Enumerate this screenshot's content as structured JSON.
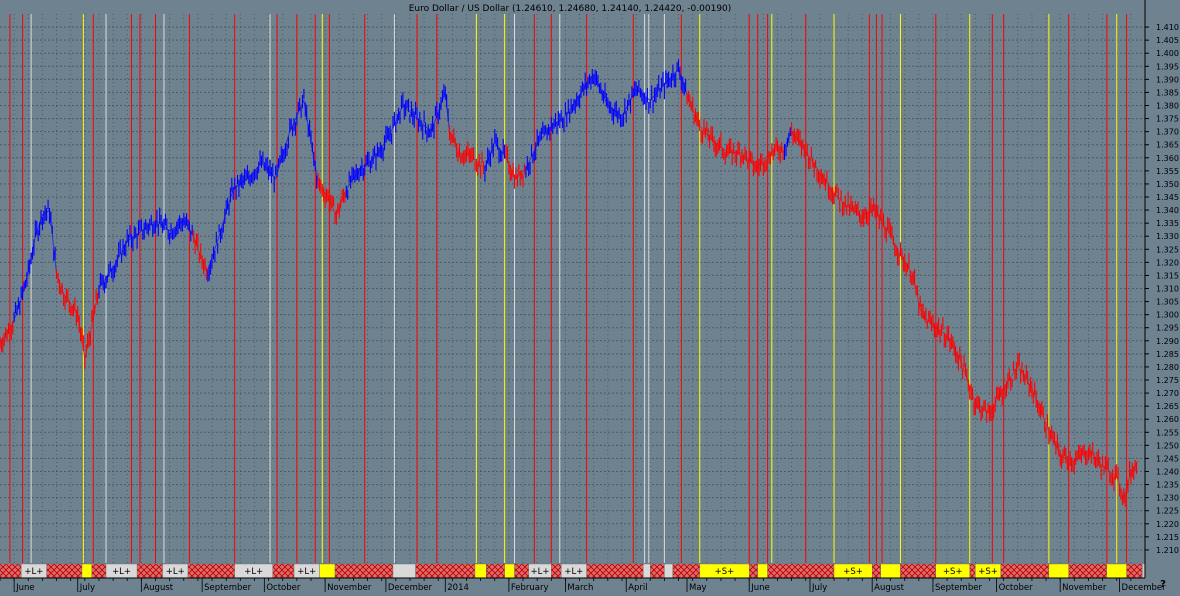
{
  "title": "Euro Dollar / US Dollar (1.24610, 1.24680, 1.24140, 1.24420, -0.00190)",
  "corner_mark": "?",
  "chart_data": {
    "type": "line",
    "title": "Euro Dollar / US Dollar (1.24610, 1.24680, 1.24140, 1.24420, -0.00190)",
    "ylim": [
      1.205,
      1.415
    ],
    "yticks": [
      "1.210",
      "1.215",
      "1.220",
      "1.225",
      "1.230",
      "1.235",
      "1.240",
      "1.245",
      "1.250",
      "1.255",
      "1.260",
      "1.265",
      "1.270",
      "1.275",
      "1.280",
      "1.285",
      "1.290",
      "1.295",
      "1.300",
      "1.305",
      "1.310",
      "1.315",
      "1.320",
      "1.325",
      "1.330",
      "1.335",
      "1.340",
      "1.345",
      "1.350",
      "1.355",
      "1.360",
      "1.365",
      "1.370",
      "1.375",
      "1.380",
      "1.385",
      "1.390",
      "1.395",
      "1.400",
      "1.405",
      "1.410"
    ],
    "month_labels": [
      {
        "label": "June",
        "week": 1
      },
      {
        "label": "July",
        "week": 5.5
      },
      {
        "label": "August",
        "week": 10
      },
      {
        "label": "September",
        "week": 14.3
      },
      {
        "label": "October",
        "week": 18.7
      },
      {
        "label": "November",
        "week": 23
      },
      {
        "label": "December",
        "week": 27.3
      },
      {
        "label": "2014",
        "week": 31.5
      },
      {
        "label": "February",
        "week": 36
      },
      {
        "label": "March",
        "week": 40
      },
      {
        "label": "April",
        "week": 44.3
      },
      {
        "label": "May",
        "week": 48.6
      },
      {
        "label": "June",
        "week": 53
      },
      {
        "label": "July",
        "week": 57.3
      },
      {
        "label": "August",
        "week": 61.7
      },
      {
        "label": "September",
        "week": 66
      },
      {
        "label": "October",
        "week": 70.5
      },
      {
        "label": "November",
        "week": 75
      },
      {
        "label": "December",
        "week": 79.2
      }
    ],
    "series": [
      {
        "color": "#ff0000",
        "points": [
          [
            0,
            1.289
          ],
          [
            0.6,
            1.294
          ],
          [
            1.0,
            1.298
          ]
        ]
      },
      {
        "color": "#0000ff",
        "points": [
          [
            1.0,
            1.298
          ],
          [
            1.5,
            1.306
          ],
          [
            2,
            1.316
          ],
          [
            2.5,
            1.33
          ],
          [
            3,
            1.338
          ],
          [
            3.5,
            1.34
          ],
          [
            4,
            1.316
          ]
        ]
      },
      {
        "color": "#ff0000",
        "points": [
          [
            4,
            1.316
          ],
          [
            4.5,
            1.308
          ],
          [
            5,
            1.304
          ],
          [
            5.5,
            1.3
          ],
          [
            6,
            1.283
          ],
          [
            6.5,
            1.296
          ],
          [
            7,
            1.31
          ]
        ]
      },
      {
        "color": "#0000ff",
        "points": [
          [
            7,
            1.31
          ],
          [
            8,
            1.318
          ],
          [
            9,
            1.328
          ],
          [
            10,
            1.332
          ],
          [
            11,
            1.336
          ],
          [
            12,
            1.332
          ],
          [
            13,
            1.336
          ],
          [
            13.7,
            1.33
          ]
        ]
      },
      {
        "color": "#ff0000",
        "points": [
          [
            13.7,
            1.33
          ],
          [
            14.2,
            1.322
          ],
          [
            14.7,
            1.317
          ]
        ]
      },
      {
        "color": "#0000ff",
        "points": [
          [
            14.7,
            1.317
          ],
          [
            15.5,
            1.33
          ],
          [
            16.5,
            1.348
          ],
          [
            17.5,
            1.352
          ],
          [
            18.5,
            1.358
          ],
          [
            19.5,
            1.352
          ],
          [
            20.5,
            1.37
          ],
          [
            21.5,
            1.382
          ],
          [
            22.5,
            1.35
          ]
        ]
      },
      {
        "color": "#ff0000",
        "points": [
          [
            22.5,
            1.35
          ],
          [
            23.2,
            1.345
          ],
          [
            23.8,
            1.338
          ],
          [
            24.5,
            1.348
          ]
        ]
      },
      {
        "color": "#0000ff",
        "points": [
          [
            24.5,
            1.348
          ],
          [
            25.5,
            1.356
          ],
          [
            26.5,
            1.36
          ],
          [
            27.5,
            1.368
          ],
          [
            28.5,
            1.38
          ],
          [
            29.5,
            1.375
          ],
          [
            30.5,
            1.37
          ],
          [
            31.5,
            1.385
          ],
          [
            31.8,
            1.37
          ]
        ]
      },
      {
        "color": "#ff0000",
        "points": [
          [
            31.8,
            1.37
          ],
          [
            32.5,
            1.362
          ],
          [
            33.5,
            1.36
          ],
          [
            34.3,
            1.356
          ]
        ]
      },
      {
        "color": "#0000ff",
        "points": [
          [
            34.3,
            1.356
          ],
          [
            35,
            1.366
          ],
          [
            35.8,
            1.36
          ]
        ]
      },
      {
        "color": "#ff0000",
        "points": [
          [
            35.8,
            1.36
          ],
          [
            36.5,
            1.352
          ],
          [
            37.2,
            1.356
          ]
        ]
      },
      {
        "color": "#0000ff",
        "points": [
          [
            37.2,
            1.356
          ],
          [
            38,
            1.365
          ],
          [
            39,
            1.372
          ],
          [
            40,
            1.376
          ],
          [
            41,
            1.384
          ],
          [
            42,
            1.392
          ],
          [
            43,
            1.38
          ],
          [
            44,
            1.376
          ],
          [
            45,
            1.386
          ],
          [
            46,
            1.382
          ],
          [
            47,
            1.388
          ],
          [
            48,
            1.394
          ],
          [
            48.6,
            1.384
          ]
        ]
      },
      {
        "color": "#ff0000",
        "points": [
          [
            48.6,
            1.384
          ],
          [
            49.5,
            1.372
          ],
          [
            50.5,
            1.366
          ],
          [
            51.5,
            1.362
          ],
          [
            52.5,
            1.362
          ],
          [
            53.5,
            1.356
          ],
          [
            54.5,
            1.362
          ],
          [
            55.5,
            1.364
          ]
        ]
      },
      {
        "color": "#0000ff",
        "points": [
          [
            55.5,
            1.364
          ],
          [
            56,
            1.37
          ]
        ]
      },
      {
        "color": "#ff0000",
        "points": [
          [
            56,
            1.37
          ],
          [
            56.8,
            1.364
          ],
          [
            57.8,
            1.356
          ],
          [
            58.8,
            1.348
          ],
          [
            59.8,
            1.342
          ],
          [
            60.8,
            1.338
          ],
          [
            61.8,
            1.34
          ],
          [
            62.8,
            1.332
          ],
          [
            63.8,
            1.322
          ],
          [
            64.5,
            1.316
          ],
          [
            65.2,
            1.3
          ],
          [
            66,
            1.296
          ],
          [
            67,
            1.292
          ],
          [
            68,
            1.282
          ],
          [
            69,
            1.266
          ],
          [
            70,
            1.262
          ],
          [
            71,
            1.272
          ],
          [
            72,
            1.28
          ],
          [
            73,
            1.272
          ],
          [
            74,
            1.258
          ],
          [
            75,
            1.246
          ],
          [
            76,
            1.244
          ],
          [
            77,
            1.248
          ],
          [
            78,
            1.242
          ],
          [
            79,
            1.238
          ],
          [
            79.5,
            1.23
          ],
          [
            80,
            1.24
          ],
          [
            80.5,
            1.244
          ]
        ]
      }
    ],
    "vertical_lines": [
      {
        "week": 0.7,
        "color": "#ff0000"
      },
      {
        "week": 1.6,
        "color": "#ff0000"
      },
      {
        "week": 2.2,
        "color": "#dddddd"
      },
      {
        "week": 5.9,
        "color": "#ffff00"
      },
      {
        "week": 6.6,
        "color": "#ff0000"
      },
      {
        "week": 7.5,
        "color": "#dddddd"
      },
      {
        "week": 9.3,
        "color": "#ff0000"
      },
      {
        "week": 9.9,
        "color": "#ff0000"
      },
      {
        "week": 11.0,
        "color": "#ff0000"
      },
      {
        "week": 11.6,
        "color": "#dddddd"
      },
      {
        "week": 13.4,
        "color": "#ff0000"
      },
      {
        "week": 16.6,
        "color": "#ff0000"
      },
      {
        "week": 19.1,
        "color": "#dddddd"
      },
      {
        "week": 19.6,
        "color": "#ff0000"
      },
      {
        "week": 21.0,
        "color": "#ff0000"
      },
      {
        "week": 22.3,
        "color": "#ff0000"
      },
      {
        "week": 22.8,
        "color": "#ffff00"
      },
      {
        "week": 23.3,
        "color": "#ff0000"
      },
      {
        "week": 25.8,
        "color": "#ff0000"
      },
      {
        "week": 27.9,
        "color": "#dddddd"
      },
      {
        "week": 29.5,
        "color": "#ff0000"
      },
      {
        "week": 30.9,
        "color": "#ff0000"
      },
      {
        "week": 33.7,
        "color": "#ffff00"
      },
      {
        "week": 35.7,
        "color": "#ffff00"
      },
      {
        "week": 36.4,
        "color": "#dddddd"
      },
      {
        "week": 37.8,
        "color": "#ff0000"
      },
      {
        "week": 39.0,
        "color": "#ff0000"
      },
      {
        "week": 39.6,
        "color": "#dddddd"
      },
      {
        "week": 41.5,
        "color": "#ff0000"
      },
      {
        "week": 44.8,
        "color": "#ff0000"
      },
      {
        "week": 45.6,
        "color": "#dddddd"
      },
      {
        "week": 45.9,
        "color": "#dddddd"
      },
      {
        "week": 47.0,
        "color": "#dddddd"
      },
      {
        "week": 48.2,
        "color": "#ff0000"
      },
      {
        "week": 49.5,
        "color": "#ffff00"
      },
      {
        "week": 53.0,
        "color": "#ff0000"
      },
      {
        "week": 53.6,
        "color": "#ff0000"
      },
      {
        "week": 54.3,
        "color": "#ff0000"
      },
      {
        "week": 54.6,
        "color": "#ffff00"
      },
      {
        "week": 57.0,
        "color": "#ff0000"
      },
      {
        "week": 59.0,
        "color": "#ffff00"
      },
      {
        "week": 61.5,
        "color": "#ff0000"
      },
      {
        "week": 62.0,
        "color": "#ff0000"
      },
      {
        "week": 62.4,
        "color": "#ff0000"
      },
      {
        "week": 63.7,
        "color": "#ffff00"
      },
      {
        "week": 66.2,
        "color": "#ff0000"
      },
      {
        "week": 68.6,
        "color": "#ffff00"
      },
      {
        "week": 70.2,
        "color": "#ff0000"
      },
      {
        "week": 71.0,
        "color": "#ff0000"
      },
      {
        "week": 74.2,
        "color": "#ffff00"
      },
      {
        "week": 75.6,
        "color": "#ff0000"
      },
      {
        "week": 78.3,
        "color": "#ff0000"
      },
      {
        "week": 79.0,
        "color": "#ffff00"
      },
      {
        "week": 79.7,
        "color": "#ff0000"
      }
    ],
    "signal_bar": [
      {
        "start": 0,
        "end": 1.5,
        "kind": "red"
      },
      {
        "start": 1.5,
        "end": 3.3,
        "kind": "white",
        "label": "+L+"
      },
      {
        "start": 3.3,
        "end": 5.8,
        "kind": "red"
      },
      {
        "start": 5.8,
        "end": 6.5,
        "kind": "yellow"
      },
      {
        "start": 6.5,
        "end": 7.5,
        "kind": "red"
      },
      {
        "start": 7.5,
        "end": 9.7,
        "kind": "white",
        "label": "+L+"
      },
      {
        "start": 9.7,
        "end": 11.5,
        "kind": "red"
      },
      {
        "start": 11.5,
        "end": 13.3,
        "kind": "white",
        "label": "+L+"
      },
      {
        "start": 13.3,
        "end": 16.6,
        "kind": "red"
      },
      {
        "start": 16.6,
        "end": 19.3,
        "kind": "white",
        "label": "+L+"
      },
      {
        "start": 19.3,
        "end": 20.8,
        "kind": "red"
      },
      {
        "start": 20.8,
        "end": 22.6,
        "kind": "white",
        "label": "+L+"
      },
      {
        "start": 22.6,
        "end": 23.7,
        "kind": "yellow"
      },
      {
        "start": 23.7,
        "end": 27.8,
        "kind": "red"
      },
      {
        "start": 27.8,
        "end": 29.4,
        "kind": "white"
      },
      {
        "start": 29.4,
        "end": 33.6,
        "kind": "red"
      },
      {
        "start": 33.6,
        "end": 34.4,
        "kind": "yellow"
      },
      {
        "start": 34.4,
        "end": 35.7,
        "kind": "red"
      },
      {
        "start": 35.7,
        "end": 36.4,
        "kind": "yellow"
      },
      {
        "start": 36.4,
        "end": 37.4,
        "kind": "red"
      },
      {
        "start": 37.4,
        "end": 39.0,
        "kind": "white",
        "label": "+L+"
      },
      {
        "start": 39.0,
        "end": 39.7,
        "kind": "red"
      },
      {
        "start": 39.7,
        "end": 41.5,
        "kind": "white",
        "label": "+L+"
      },
      {
        "start": 41.5,
        "end": 45.5,
        "kind": "red"
      },
      {
        "start": 45.5,
        "end": 46.0,
        "kind": "white"
      },
      {
        "start": 46.0,
        "end": 47.0,
        "kind": "red"
      },
      {
        "start": 47.0,
        "end": 47.6,
        "kind": "white"
      },
      {
        "start": 47.6,
        "end": 49.5,
        "kind": "red"
      },
      {
        "start": 49.5,
        "end": 53.0,
        "kind": "yellow",
        "label": "+S+"
      },
      {
        "start": 53.0,
        "end": 53.6,
        "kind": "red"
      },
      {
        "start": 53.6,
        "end": 54.3,
        "kind": "yellow"
      },
      {
        "start": 54.3,
        "end": 59.0,
        "kind": "red"
      },
      {
        "start": 59.0,
        "end": 61.7,
        "kind": "yellow",
        "label": "+S+"
      },
      {
        "start": 61.7,
        "end": 62.3,
        "kind": "red"
      },
      {
        "start": 62.3,
        "end": 63.7,
        "kind": "yellow"
      },
      {
        "start": 63.7,
        "end": 66.2,
        "kind": "red"
      },
      {
        "start": 66.2,
        "end": 68.6,
        "kind": "yellow",
        "label": "+S+"
      },
      {
        "start": 68.6,
        "end": 69.0,
        "kind": "red"
      },
      {
        "start": 69.0,
        "end": 70.8,
        "kind": "yellow",
        "label": "+S+"
      },
      {
        "start": 70.8,
        "end": 74.2,
        "kind": "red"
      },
      {
        "start": 74.2,
        "end": 75.6,
        "kind": "yellow"
      },
      {
        "start": 75.6,
        "end": 78.3,
        "kind": "red"
      },
      {
        "start": 78.3,
        "end": 79.7,
        "kind": "yellow"
      },
      {
        "start": 79.7,
        "end": 80.8,
        "kind": "red"
      }
    ],
    "grid": true,
    "x_range": [
      0,
      81
    ],
    "colors": {
      "background": "#6e8290",
      "up": "#0000ff",
      "down": "#ff0000",
      "grid": "#4c5963",
      "axis_text": "#000000",
      "signal_white": "#d9d9d9",
      "signal_yellow": "#ffff00",
      "signal_red": "#ff5a5a"
    }
  }
}
